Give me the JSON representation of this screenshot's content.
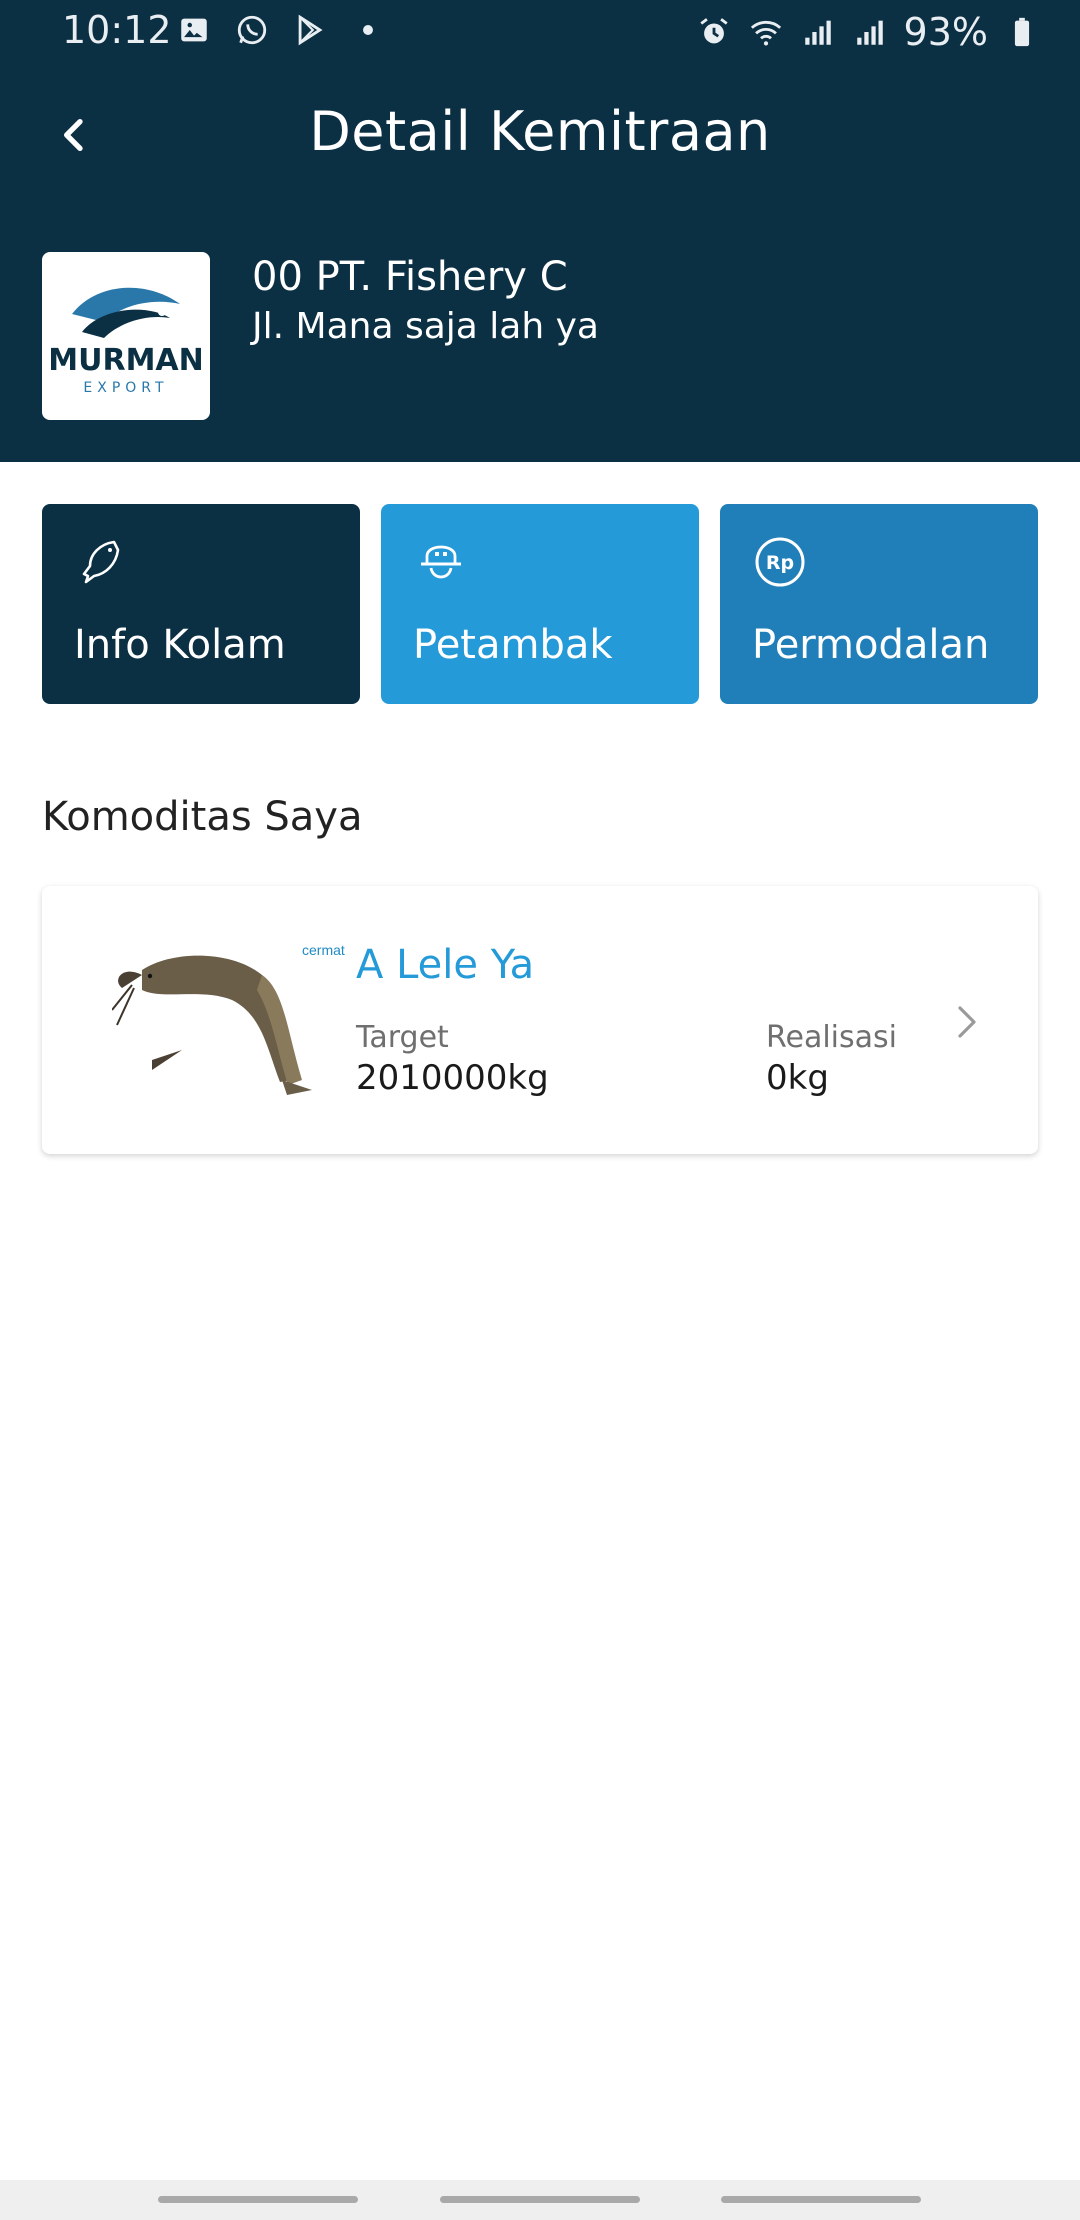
{
  "status_bar": {
    "time": "10:12",
    "battery": "93%",
    "left_icons": [
      "image-icon",
      "whatsapp-icon",
      "play-store-icon",
      "dot-icon"
    ],
    "right_icons": [
      "alarm-icon",
      "wifi-icon",
      "signal-icon",
      "signal-icon",
      "battery-icon"
    ]
  },
  "header": {
    "title": "Detail Kemitraan",
    "company_name": "00 PT. Fishery C",
    "company_address": "Jl. Mana saja lah ya",
    "logo_text": "MURMAN",
    "logo_subtext": "EXPORT"
  },
  "tiles": [
    {
      "label": "Info Kolam",
      "icon": "fish-icon",
      "color": "#0b2f43"
    },
    {
      "label": "Petambak",
      "icon": "farmer-hat-icon",
      "color": "#259ad8"
    },
    {
      "label": "Permodalan",
      "icon": "rupiah-icon",
      "color": "#207fb8"
    }
  ],
  "section_title": "Komoditas Saya",
  "commodity": {
    "name": "A Lele Ya",
    "image_brand": "cermat",
    "target_label": "Target",
    "target_value": "2010000kg",
    "realization_label": "Realisasi",
    "realization_value": "0kg"
  },
  "colors": {
    "primary_dark": "#0b2f43",
    "primary_light": "#259ad8",
    "primary_mid": "#207fb8"
  }
}
